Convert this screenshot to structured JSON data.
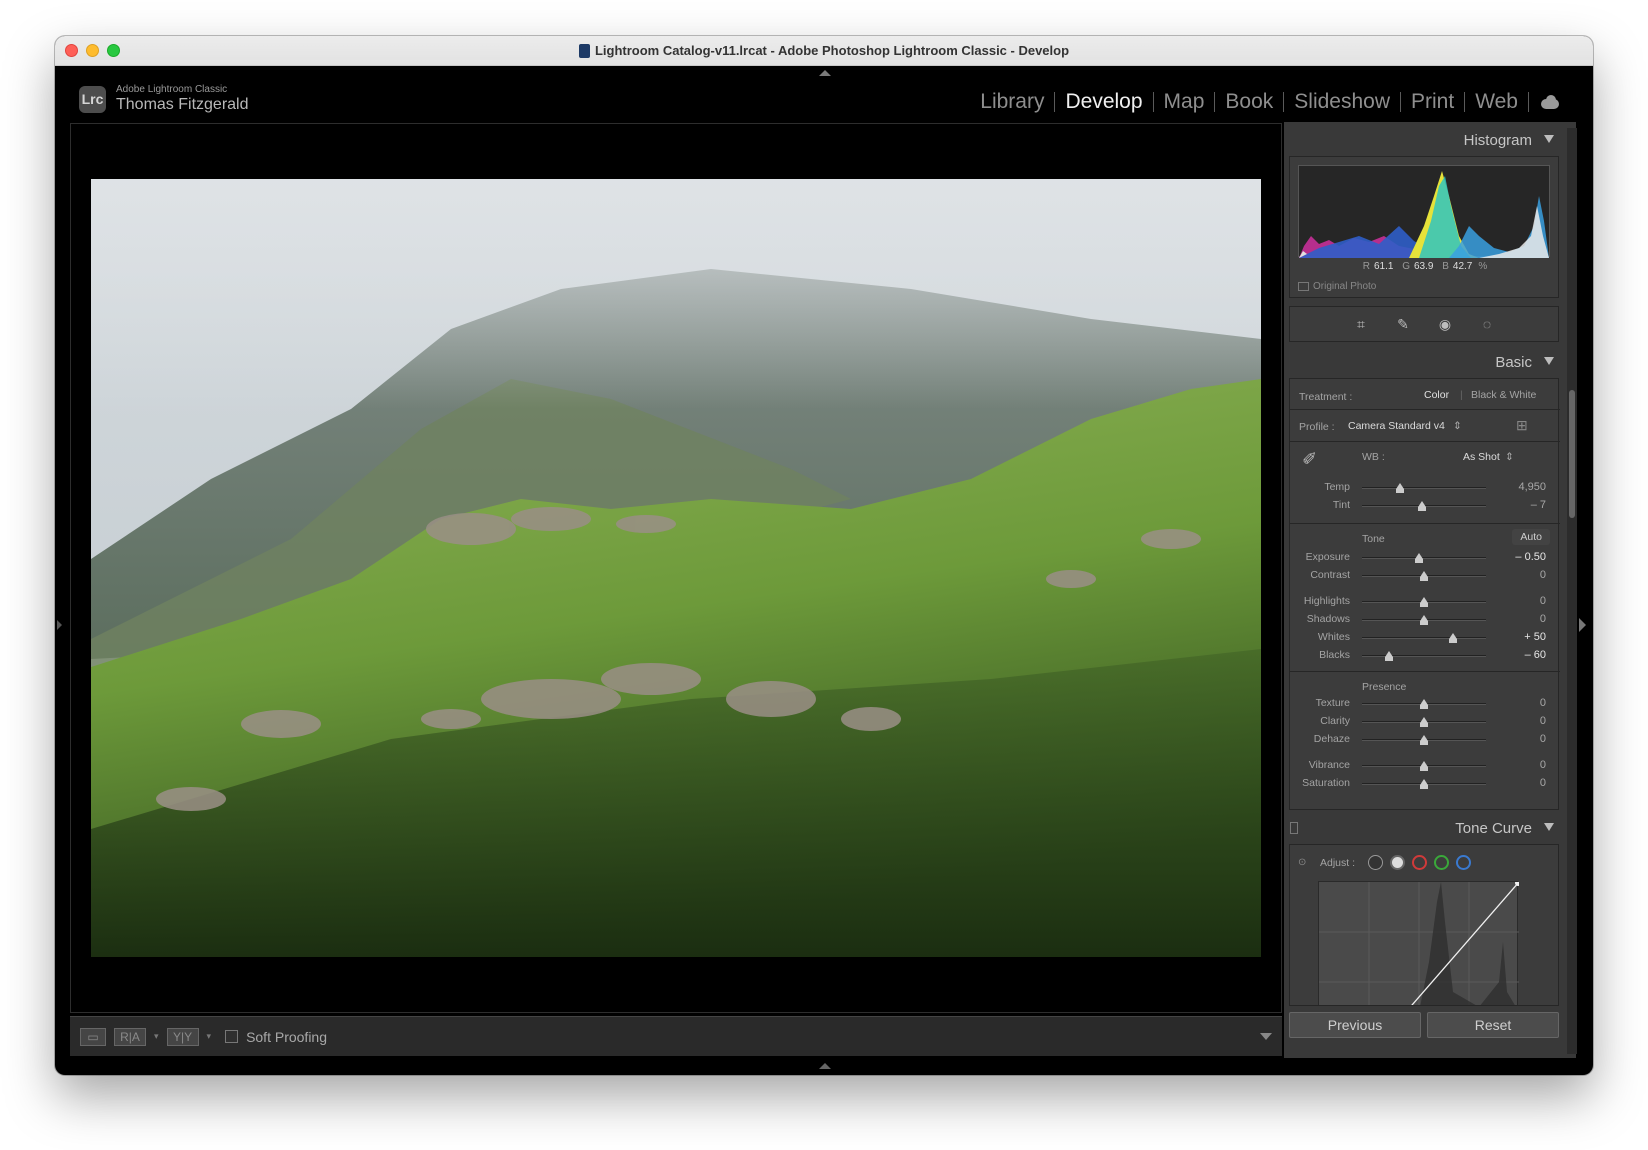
{
  "window": {
    "title": "Lightroom Catalog-v11.lrcat - Adobe Photoshop Lightroom Classic - Develop"
  },
  "identity": {
    "logo": "Lrc",
    "app_name": "Adobe Lightroom Classic",
    "user": "Thomas Fitzgerald"
  },
  "modules": [
    {
      "label": "Library",
      "active": false
    },
    {
      "label": "Develop",
      "active": true
    },
    {
      "label": "Map",
      "active": false
    },
    {
      "label": "Book",
      "active": false
    },
    {
      "label": "Slideshow",
      "active": false
    },
    {
      "label": "Print",
      "active": false
    },
    {
      "label": "Web",
      "active": false
    }
  ],
  "toolbar": {
    "soft_proofing_label": "Soft Proofing",
    "view_compare_1": "R|A",
    "view_compare_2": "Y|Y"
  },
  "histogram": {
    "title": "Histogram",
    "readout": {
      "r_label": "R",
      "r_value": "61.1",
      "g_label": "G",
      "g_value": "63.9",
      "b_label": "B",
      "b_value": "42.7",
      "unit": "%"
    },
    "original_photo_label": "Original Photo"
  },
  "basic": {
    "title": "Basic",
    "treatment_label": "Treatment :",
    "treatment_color": "Color",
    "treatment_bw": "Black & White",
    "profile_label": "Profile :",
    "profile_value": "Camera Standard v4",
    "wb_label": "WB :",
    "wb_value": "As Shot",
    "tone_label": "Tone",
    "auto_label": "Auto",
    "presence_label": "Presence",
    "sliders": [
      {
        "name": "temp",
        "label": "Temp",
        "value": "4,950",
        "position": 0.31
      },
      {
        "name": "tint",
        "label": "Tint",
        "value": "– 7",
        "position": 0.48
      },
      {
        "name": "exposure",
        "label": "Exposure",
        "value": "– 0.50",
        "position": 0.46
      },
      {
        "name": "contrast",
        "label": "Contrast",
        "value": "0",
        "position": 0.5
      },
      {
        "name": "highlights",
        "label": "Highlights",
        "value": "0",
        "position": 0.5
      },
      {
        "name": "shadows",
        "label": "Shadows",
        "value": "0",
        "position": 0.5
      },
      {
        "name": "whites",
        "label": "Whites",
        "value": "+ 50",
        "position": 0.73
      },
      {
        "name": "blacks",
        "label": "Blacks",
        "value": "– 60",
        "position": 0.22
      },
      {
        "name": "texture",
        "label": "Texture",
        "value": "0",
        "position": 0.5
      },
      {
        "name": "clarity",
        "label": "Clarity",
        "value": "0",
        "position": 0.5
      },
      {
        "name": "dehaze",
        "label": "Dehaze",
        "value": "0",
        "position": 0.5
      },
      {
        "name": "vibrance",
        "label": "Vibrance",
        "value": "0",
        "position": 0.5
      },
      {
        "name": "saturation",
        "label": "Saturation",
        "value": "0",
        "position": 0.5
      }
    ]
  },
  "tone_curve": {
    "title": "Tone Curve",
    "adjust_label": "Adjust :"
  },
  "buttons": {
    "previous": "Previous",
    "reset": "Reset"
  },
  "colors": {
    "panel_bg": "#393939",
    "accent_text": "#f0f0f0",
    "red_channel": "#d03a3a",
    "green_channel": "#3aa83a",
    "blue_channel": "#3a7ad0"
  }
}
